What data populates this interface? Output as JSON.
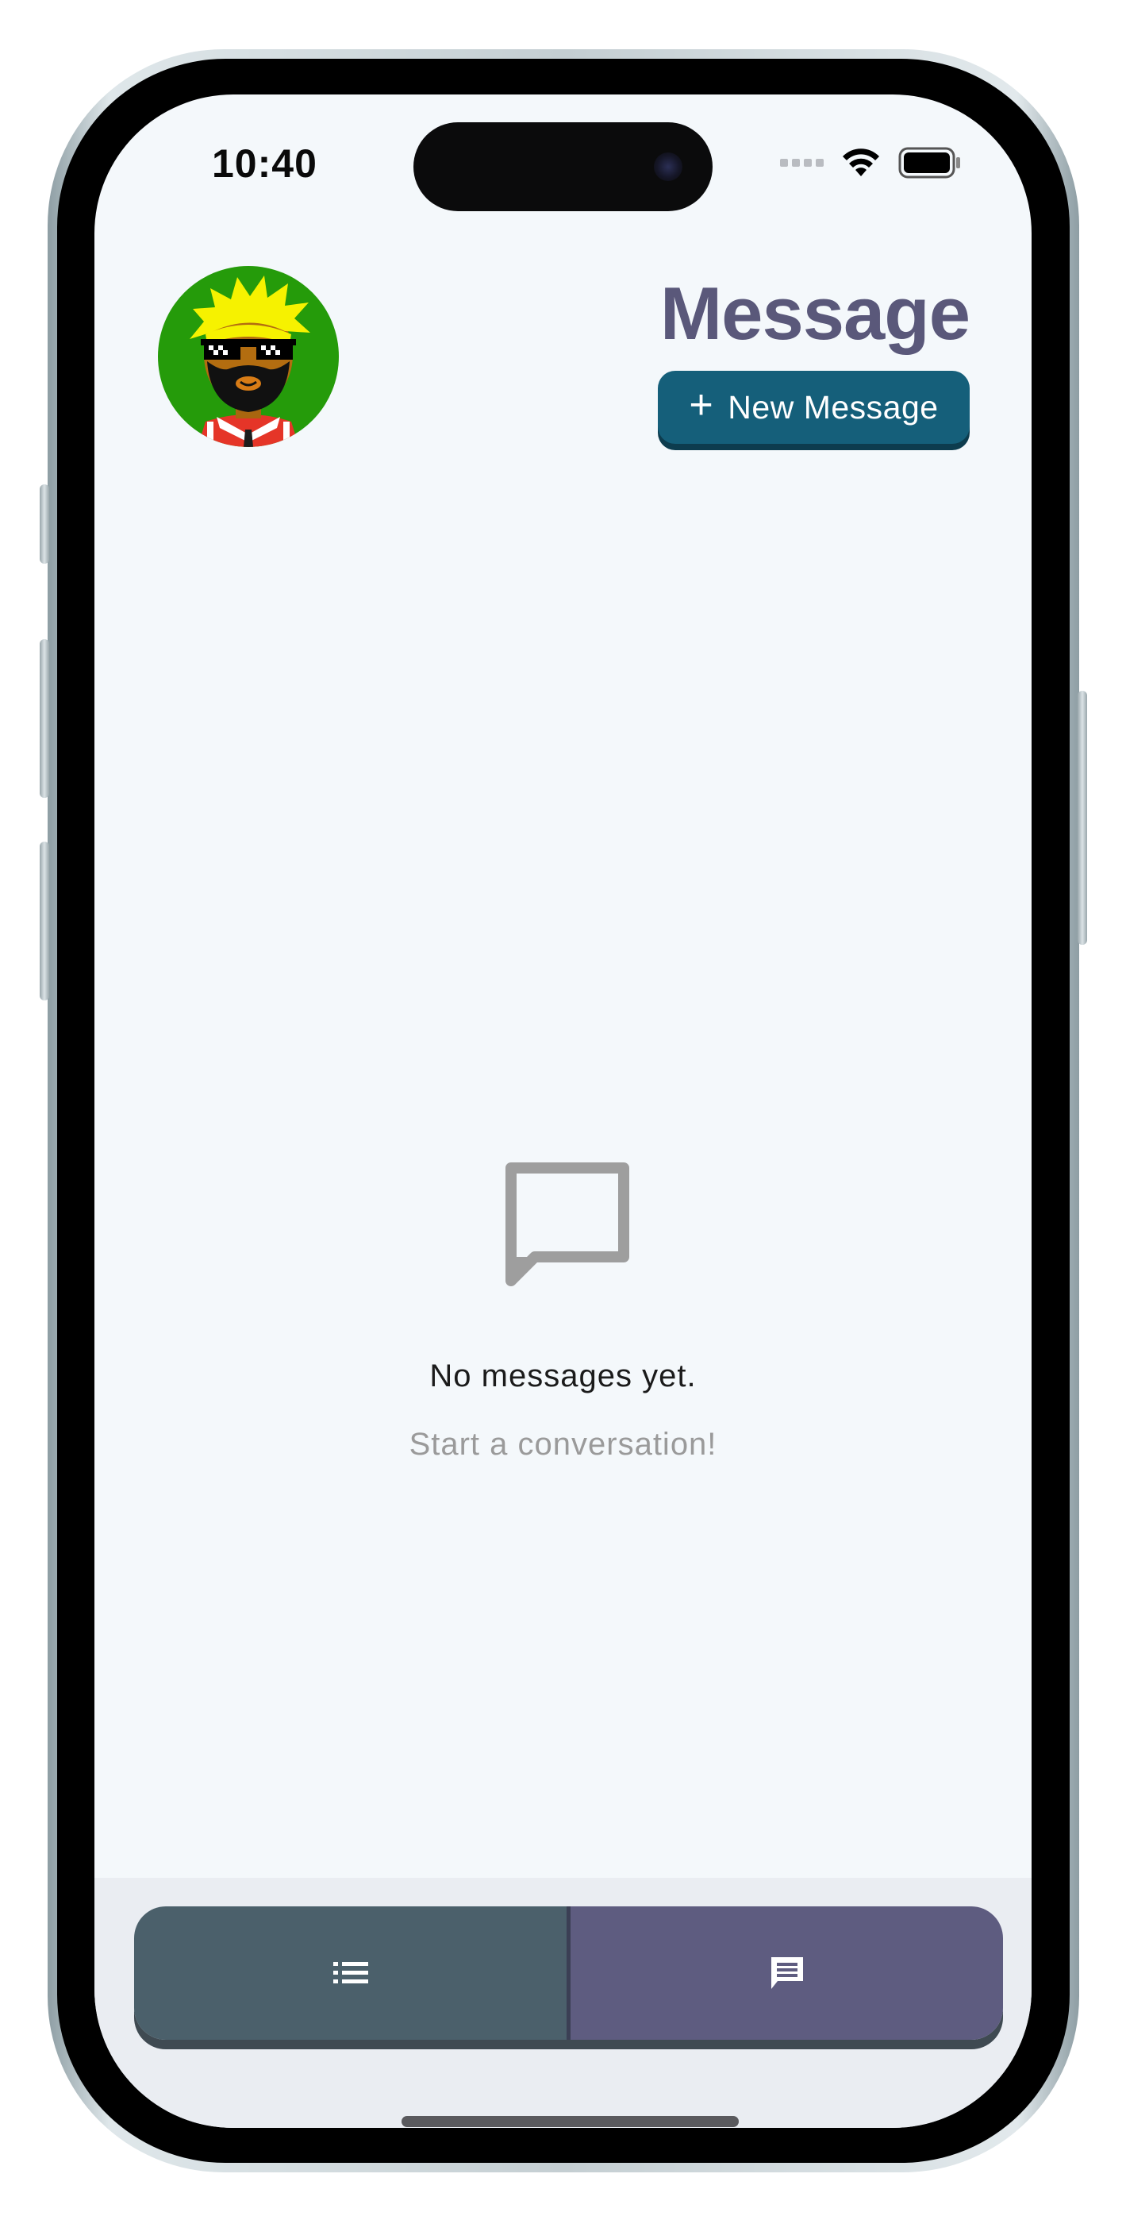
{
  "status_bar": {
    "time": "10:40",
    "icons": [
      "cellular-dots-icon",
      "wifi-icon",
      "battery-icon"
    ]
  },
  "header": {
    "title": "Message",
    "new_message_button": {
      "plus": "+",
      "label": "New Message"
    }
  },
  "empty_state": {
    "icon": "chat-bubble-outline-icon",
    "title": "No messages yet.",
    "subtitle": "Start a conversation!"
  },
  "tab_bar": {
    "tabs": [
      {
        "icon": "list-icon",
        "active": false
      },
      {
        "icon": "chat-icon",
        "active": true
      }
    ]
  },
  "colors": {
    "screen_background": "#f4f8fb",
    "title": "#5a587a",
    "button": "#155f7a",
    "tab_list": "#4b606b",
    "tab_chat": "#5e5c80",
    "avatar_background": "#259b0a"
  }
}
